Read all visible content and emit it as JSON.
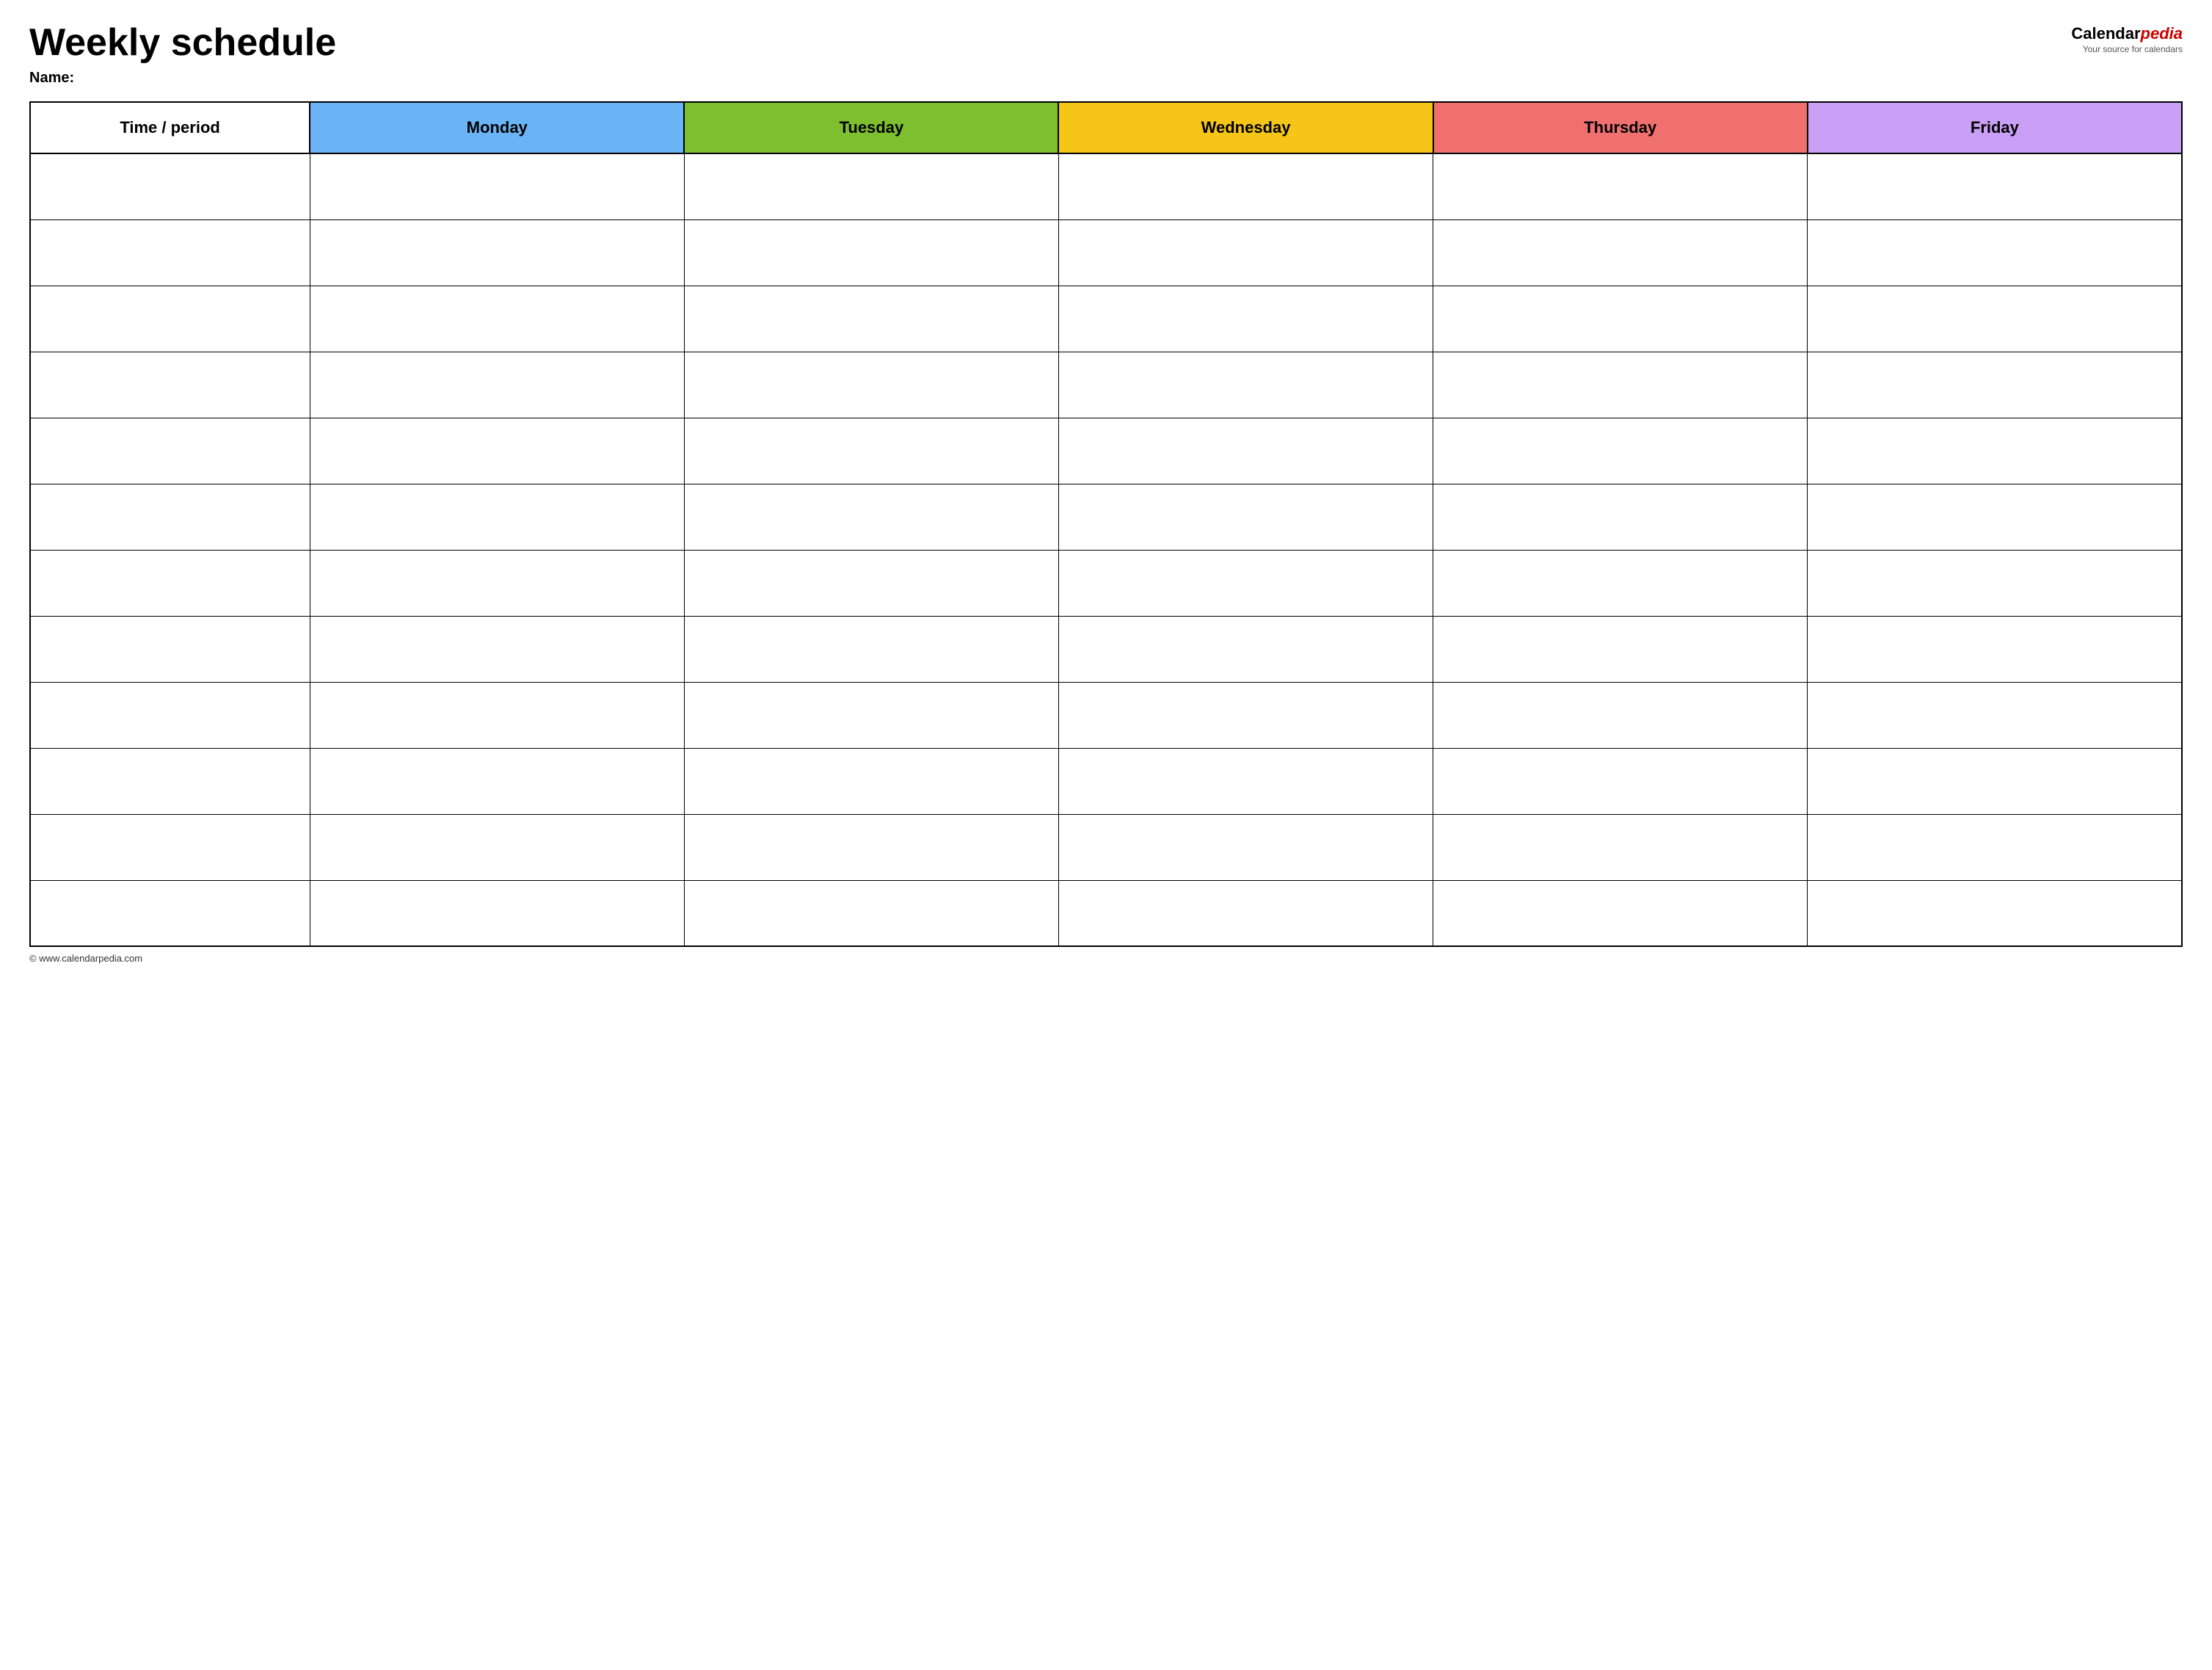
{
  "header": {
    "title": "Weekly schedule",
    "name_label": "Name:",
    "logo_calendar": "Calendar",
    "logo_pedia": "pedia",
    "logo_tagline": "Your source for calendars"
  },
  "table": {
    "columns": [
      {
        "id": "time",
        "label": "Time / period",
        "color": "#fff"
      },
      {
        "id": "monday",
        "label": "Monday",
        "color": "#6ab4f5"
      },
      {
        "id": "tuesday",
        "label": "Tuesday",
        "color": "#7dbf2e"
      },
      {
        "id": "wednesday",
        "label": "Wednesday",
        "color": "#f5c518"
      },
      {
        "id": "thursday",
        "label": "Thursday",
        "color": "#f07070"
      },
      {
        "id": "friday",
        "label": "Friday",
        "color": "#c9a0f5"
      }
    ],
    "row_count": 12
  },
  "footer": {
    "copyright": "© www.calendarpedia.com"
  }
}
